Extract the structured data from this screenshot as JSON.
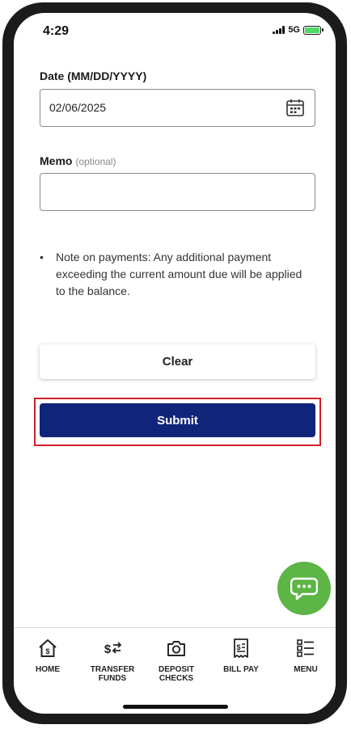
{
  "status": {
    "time": "4:29",
    "network": "5G"
  },
  "form": {
    "date_label": "Date (MM/DD/YYYY)",
    "date_value": "02/06/2025",
    "memo_label": "Memo",
    "memo_optional": "(optional)",
    "memo_value": ""
  },
  "note": {
    "text": "Note on payments: Any additional payment exceeding the current amount due will be applied to the balance."
  },
  "buttons": {
    "clear": "Clear",
    "submit": "Submit"
  },
  "nav": {
    "home": "HOME",
    "transfer_1": "TRANSFER",
    "transfer_2": "FUNDS",
    "deposit_1": "DEPOSIT",
    "deposit_2": "CHECKS",
    "billpay": "BILL PAY",
    "menu": "MENU"
  },
  "colors": {
    "primary": "#10247a",
    "chat": "#5cb544",
    "highlight": "#d0202a",
    "battery": "#4cd964"
  }
}
